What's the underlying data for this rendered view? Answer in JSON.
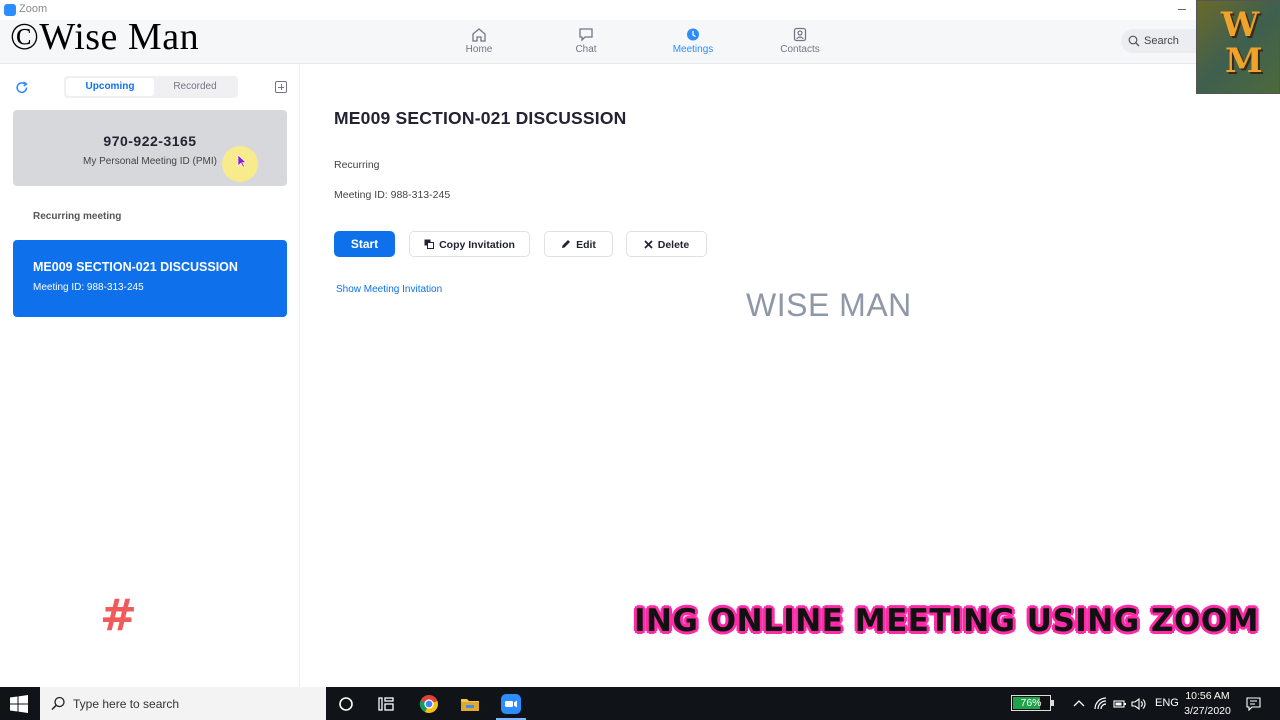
{
  "window": {
    "title": "Zoom"
  },
  "watermark": {
    "top_left": "©Wise Man",
    "center": "WISE MAN",
    "logo_letters": [
      "W",
      "M"
    ],
    "banner": "ING ONLINE MEETING USING ZOOM",
    "hash_symbol": "#"
  },
  "nav": {
    "tabs": [
      {
        "label": "Home",
        "icon": "home-icon",
        "active": false
      },
      {
        "label": "Chat",
        "icon": "chat-icon",
        "active": false
      },
      {
        "label": "Meetings",
        "icon": "clock-icon",
        "active": true
      },
      {
        "label": "Contacts",
        "icon": "contacts-icon",
        "active": false
      }
    ],
    "search_placeholder": "Search",
    "accent_color": "#2d8cff"
  },
  "sidebar": {
    "segments": [
      {
        "label": "Upcoming",
        "selected": true
      },
      {
        "label": "Recorded",
        "selected": false
      }
    ],
    "pmi": {
      "number": "970-922-3165",
      "label": "My Personal Meeting ID (PMI)"
    },
    "section_label": "Recurring meeting",
    "meetings": [
      {
        "title": "ME009 SECTION-021 DISCUSSION",
        "meeting_id": "Meeting ID: 988-313-245",
        "selected": true
      }
    ]
  },
  "detail": {
    "title": "ME009 SECTION-021 DISCUSSION",
    "recurrence": "Recurring",
    "meeting_id": "Meeting ID: 988-313-245",
    "buttons": {
      "start": "Start",
      "copy": "Copy Invitation",
      "edit": "Edit",
      "delete": "Delete"
    },
    "show_invitation": "Show Meeting Invitation"
  },
  "taskbar": {
    "search_placeholder": "Type here to search",
    "battery": "76%",
    "battery_level": 0.76,
    "language": "ENG",
    "time": "10:56 AM",
    "date": "3/27/2020"
  }
}
